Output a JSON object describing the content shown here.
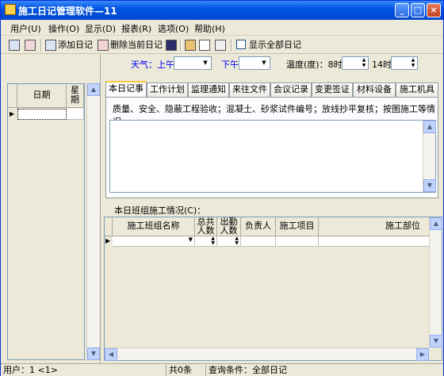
{
  "window": {
    "title": "施工日记管理软件—11"
  },
  "title_buttons": {
    "minimize": "_",
    "maximize": "□",
    "close": "×"
  },
  "menu": [
    {
      "label": "用户(U)"
    },
    {
      "label": "操作(O)"
    },
    {
      "label": "显示(D)"
    },
    {
      "label": "报表(R)"
    },
    {
      "label": "选项(O)"
    },
    {
      "label": "帮助(H)"
    }
  ],
  "toolbar": {
    "add_label": "添加日记",
    "delete_label": "删除当前日记",
    "show_all_label": "显示全部日记",
    "show_all_checked": false
  },
  "left_grid": {
    "col_date": "日期",
    "col_week": "星\n期"
  },
  "weather": {
    "label_am": "天气：上午",
    "am_value": "",
    "label_pm": "下午",
    "pm_value": "",
    "label_temp": "温度(度)：8时",
    "temp8_value": "",
    "label_14": "14时",
    "temp14_value": ""
  },
  "tabs": [
    {
      "label": "本日记事",
      "active": true
    },
    {
      "label": "工作计划"
    },
    {
      "label": "监理通知"
    },
    {
      "label": "来往文件"
    },
    {
      "label": "会议记录"
    },
    {
      "label": "变更签证"
    },
    {
      "label": "材料设备"
    },
    {
      "label": "施工机具"
    }
  ],
  "tab_body": {
    "hint": "质量、安全、隐蔽工程验收；混凝土、砂浆试件编号；放线抄平复核；按图施工等情况。",
    "memo_value": ""
  },
  "team_section": {
    "label": "本日班组施工情况(C)：",
    "columns": [
      "施工班组名称",
      "总共\n人数",
      "出勤\n人数",
      "负责人",
      "施工项目",
      "施工部位"
    ]
  },
  "status": {
    "user": "用户：1 <1>",
    "count": "共0条",
    "query": "查询条件：全部日记"
  },
  "colors": {
    "title_bar": "#0054e3",
    "label_blue": "#0000ff",
    "tab_active_accent": "#ffc83c"
  }
}
